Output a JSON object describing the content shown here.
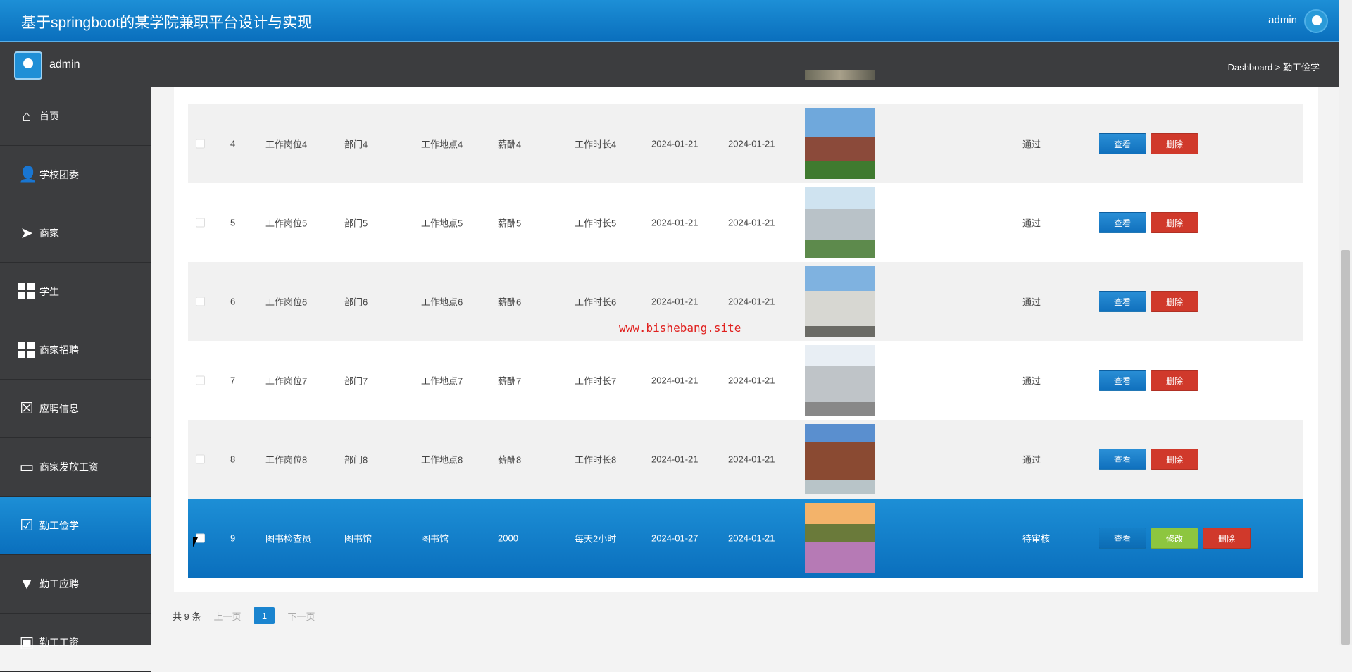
{
  "header": {
    "title": "基于springboot的某学院兼职平台设计与实现",
    "user": "admin"
  },
  "subbar": {
    "user": "admin",
    "breadcrumb": "Dashboard > 勤工俭学"
  },
  "sidebar": {
    "items": [
      {
        "label": "首页",
        "icon": "home-icon"
      },
      {
        "label": "学校团委",
        "icon": "user-icon"
      },
      {
        "label": "商家",
        "icon": "paper-plane-icon"
      },
      {
        "label": "学生",
        "icon": "grid-icon"
      },
      {
        "label": "商家招聘",
        "icon": "grid-icon"
      },
      {
        "label": "应聘信息",
        "icon": "document-x-icon"
      },
      {
        "label": "商家发放工资",
        "icon": "inbox-icon"
      },
      {
        "label": "勤工俭学",
        "icon": "clipboard-check-icon",
        "active": true
      },
      {
        "label": "勤工应聘",
        "icon": "brush-icon"
      },
      {
        "label": "勤工工资",
        "icon": "clipboard-icon"
      }
    ]
  },
  "table": {
    "rows": [
      {
        "id": "4",
        "post": "工作岗位4",
        "dept": "部门4",
        "location": "工作地点4",
        "salary": "薪酬4",
        "duration": "工作时长4",
        "date1": "2024-01-21",
        "date2": "2024-01-21",
        "status": "通过"
      },
      {
        "id": "5",
        "post": "工作岗位5",
        "dept": "部门5",
        "location": "工作地点5",
        "salary": "薪酬5",
        "duration": "工作时长5",
        "date1": "2024-01-21",
        "date2": "2024-01-21",
        "status": "通过"
      },
      {
        "id": "6",
        "post": "工作岗位6",
        "dept": "部门6",
        "location": "工作地点6",
        "salary": "薪酬6",
        "duration": "工作时长6",
        "date1": "2024-01-21",
        "date2": "2024-01-21",
        "status": "通过"
      },
      {
        "id": "7",
        "post": "工作岗位7",
        "dept": "部门7",
        "location": "工作地点7",
        "salary": "薪酬7",
        "duration": "工作时长7",
        "date1": "2024-01-21",
        "date2": "2024-01-21",
        "status": "通过"
      },
      {
        "id": "8",
        "post": "工作岗位8",
        "dept": "部门8",
        "location": "工作地点8",
        "salary": "薪酬8",
        "duration": "工作时长8",
        "date1": "2024-01-21",
        "date2": "2024-01-21",
        "status": "通过"
      },
      {
        "id": "9",
        "post": "图书检查员",
        "dept": "图书馆",
        "location": "图书馆",
        "salary": "2000",
        "duration": "每天2小时",
        "date1": "2024-01-27",
        "date2": "2024-01-21",
        "status": "待审核",
        "selected": true
      }
    ],
    "buttons": {
      "view": "查看",
      "edit": "修改",
      "delete": "删除"
    }
  },
  "pager": {
    "total": "共 9 条",
    "prev": "上一页",
    "current": "1",
    "next": "下一页"
  },
  "watermark": "www.bishebang.site",
  "colors": {
    "primary": "#1a84cf",
    "danger": "#d0392b",
    "success": "#8dc63f",
    "sidebar": "#3c3d3f"
  }
}
